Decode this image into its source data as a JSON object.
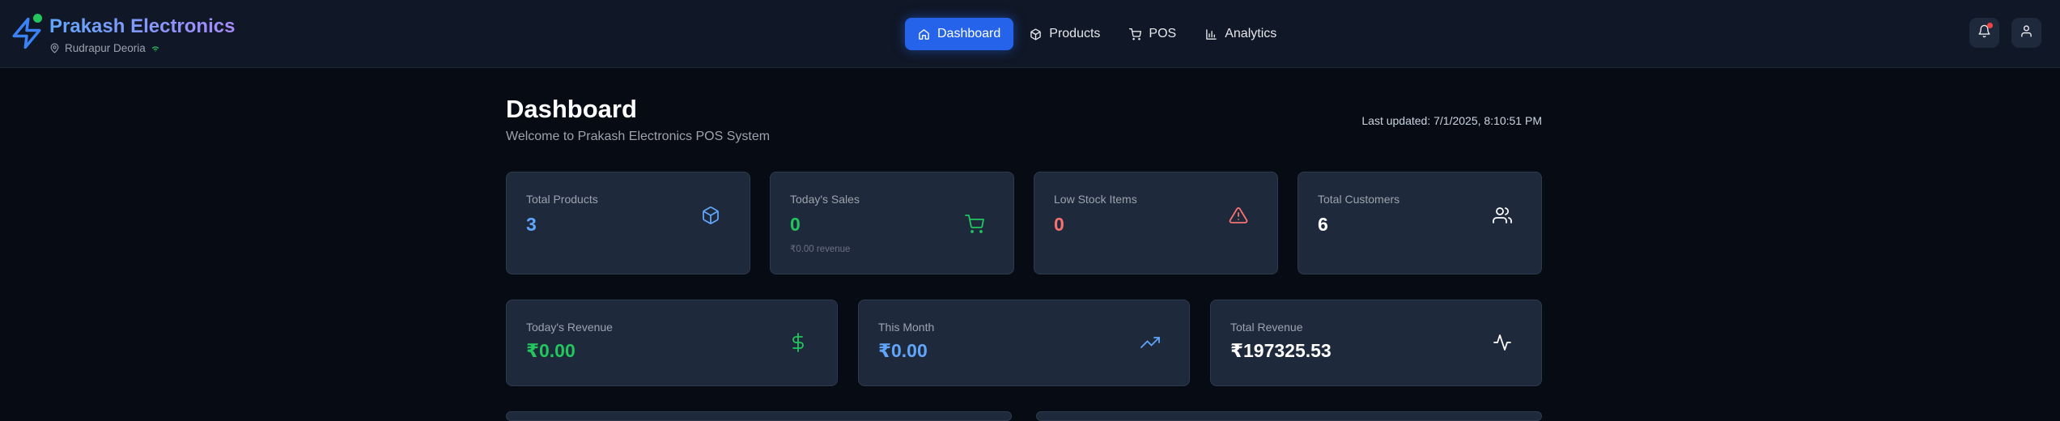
{
  "brand": {
    "title": "Prakash Electronics",
    "location": "Rudrapur Deoria",
    "icons": [
      "zap-icon",
      "map-pin-icon",
      "wifi-icon"
    ],
    "online_color": "#22c55e"
  },
  "nav": {
    "items": [
      {
        "label": "Dashboard",
        "icon": "home-icon",
        "active": true
      },
      {
        "label": "Products",
        "icon": "package-icon",
        "active": false
      },
      {
        "label": "POS",
        "icon": "cart-icon",
        "active": false
      },
      {
        "label": "Analytics",
        "icon": "bar-chart-icon",
        "active": false
      }
    ],
    "active_color": "#2563eb"
  },
  "header_actions": {
    "icons": [
      "bell-icon",
      "user-icon"
    ],
    "notification_badge_color": "#ef4444"
  },
  "page": {
    "title": "Dashboard",
    "subtitle": "Welcome to Prakash Electronics POS System",
    "last_updated": "Last updated: 7/1/2025, 8:10:51 PM"
  },
  "stats": [
    {
      "label": "Total Products",
      "value": "3",
      "note": "",
      "icon": "package-icon",
      "color": "#60a5fa"
    },
    {
      "label": "Today's Sales",
      "value": "0",
      "note": "₹0.00 revenue",
      "icon": "cart-icon",
      "color": "#22c55e"
    },
    {
      "label": "Low Stock Items",
      "value": "0",
      "note": "",
      "icon": "alert-triangle-icon",
      "color": "#f87171"
    },
    {
      "label": "Total Customers",
      "value": "6",
      "note": "",
      "icon": "users-icon",
      "color": "#ffffff"
    }
  ],
  "revenue": [
    {
      "label": "Today's Revenue",
      "value": "₹0.00",
      "icon": "dollar-icon",
      "color": "#22c55e"
    },
    {
      "label": "This Month",
      "value": "₹0.00",
      "icon": "trending-up-icon",
      "color": "#60a5fa"
    },
    {
      "label": "Total Revenue",
      "value": "₹197325.53",
      "icon": "activity-icon",
      "color": "#ffffff"
    }
  ]
}
